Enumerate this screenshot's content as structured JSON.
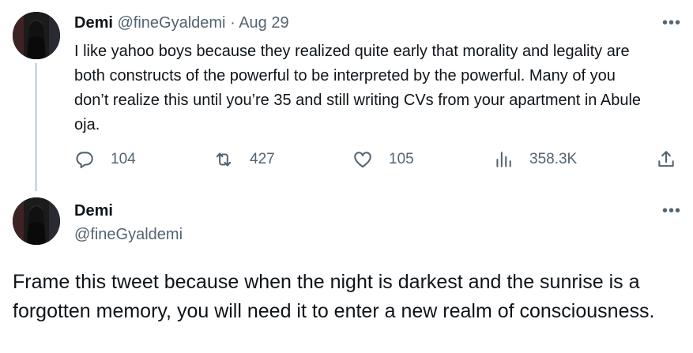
{
  "tweet1": {
    "name": "Demi",
    "handle": "@fineGyaldemi",
    "separator": "·",
    "date": "Aug 29",
    "text": "I like yahoo boys because they realized quite early that morality and legality are both constructs of the powerful to be interpreted by the powerful. Many of you don’t realize this until you’re 35 and still writing CVs from your apartment in Abule oja.",
    "replies": "104",
    "retweets": "427",
    "likes": "105",
    "views": "358.3K"
  },
  "tweet2": {
    "name": "Demi",
    "handle": "@fineGyaldemi",
    "text": "Frame this tweet because when the night is darkest and the sunrise is a forgotten memory, you will need it to enter a new realm of consciousness."
  },
  "icons": {
    "more": "more-horizontal-icon",
    "reply": "reply-icon",
    "retweet": "retweet-icon",
    "like": "heart-icon",
    "views": "views-icon",
    "share": "share-icon"
  },
  "colors": {
    "text": "#0f1419",
    "muted": "#536471",
    "thread_line": "#cfd9de"
  }
}
